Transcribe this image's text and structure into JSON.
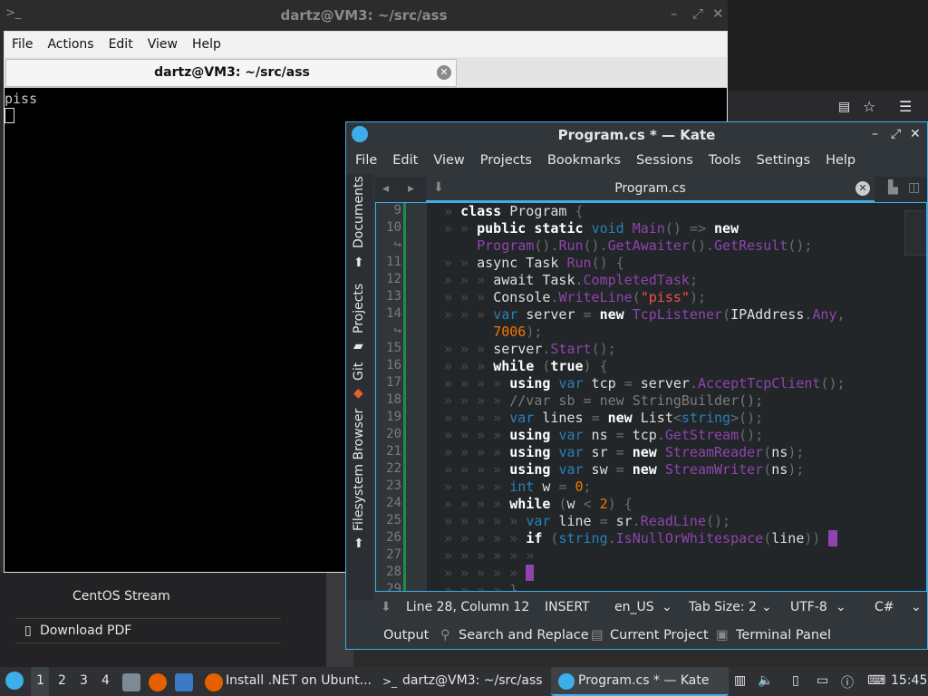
{
  "terminal": {
    "title": "dartz@VM3: ~/src/ass",
    "menu": [
      "File",
      "Actions",
      "Edit",
      "View",
      "Help"
    ],
    "tab_label": "dartz@VM3: ~/src/ass",
    "output_line": "piss"
  },
  "background": {
    "centos_label": "CentOS Stream",
    "download_label": "Download PDF"
  },
  "kate": {
    "title": "Program.cs * — Kate",
    "menu": [
      "File",
      "Edit",
      "View",
      "Projects",
      "Bookmarks",
      "Sessions",
      "Tools",
      "Settings",
      "Help"
    ],
    "sidebar": [
      "Documents",
      "Projects",
      "Git",
      "Filesystem Browser"
    ],
    "tab_label": "Program.cs",
    "status": {
      "position": "Line 28, Column 12",
      "mode": "INSERT",
      "language": "en_US",
      "tab_size": "Tab Size: 2",
      "encoding": "UTF-8",
      "syntax": "C#"
    },
    "bottom_tabs": [
      "Output",
      "Search and Replace",
      "Current Project",
      "Terminal Panel"
    ],
    "line_numbers": [
      "9",
      "10",
      "",
      "11",
      "12",
      "13",
      "14",
      "",
      "15",
      "16",
      "17",
      "18",
      "19",
      "20",
      "21",
      "22",
      "23",
      "24",
      "25",
      "26",
      "27",
      "28",
      "29"
    ]
  },
  "taskbar": {
    "workspaces": [
      "1",
      "2",
      "3",
      "4"
    ],
    "windows": [
      "Install .NET on Ubunt...",
      "dartz@VM3: ~/src/ass",
      "Program.cs * — Kate"
    ],
    "clock": "15:45"
  },
  "colors": {
    "accent": "#3daee9",
    "keyword": "#ffffff",
    "type": "#2980b9",
    "function": "#8e44ad",
    "string": "#f44f4f",
    "number": "#f67400"
  }
}
